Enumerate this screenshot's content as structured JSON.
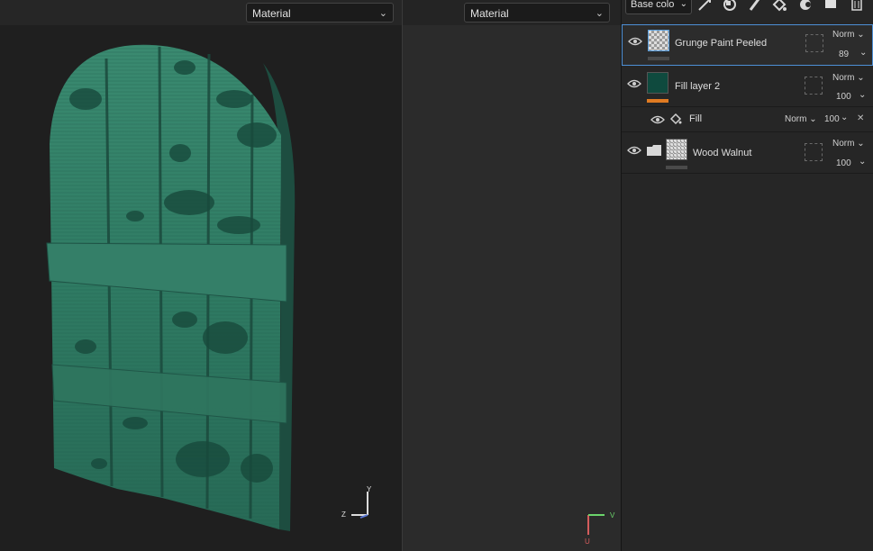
{
  "viewport_3d": {
    "material_label": "Material"
  },
  "viewport_2d": {
    "material_label": "Material"
  },
  "axes_3d": {
    "y": "Y",
    "z": "Z"
  },
  "axes_2d": {
    "v": "V",
    "u": "U"
  },
  "layers_panel": {
    "channel_select": "Base colo",
    "toolbar_icons": [
      "add-effect-icon",
      "add-mask-icon",
      "paint-icon",
      "fill-icon",
      "smart-material-icon",
      "folder-icon",
      "delete-icon"
    ],
    "layers": [
      {
        "name": "Grunge Paint Peeled",
        "blend": "Norm",
        "opacity": "89",
        "thumb": "checker",
        "selected": true
      },
      {
        "name": "Fill layer 2",
        "blend": "Norm",
        "opacity": "100",
        "thumb_color": "#0f4a3e",
        "bar_color": "#e07b22"
      },
      {
        "name": "Fill",
        "blend": "Norm",
        "opacity": "100",
        "sub_effect": true
      },
      {
        "name": "Wood Walnut",
        "blend": "Norm",
        "opacity": "100",
        "thumb": "noise",
        "folder": true
      }
    ]
  },
  "colors": {
    "accent": "#4d8fd6",
    "door_green": "#2f7a63",
    "fill_bar": "#e07b22"
  }
}
